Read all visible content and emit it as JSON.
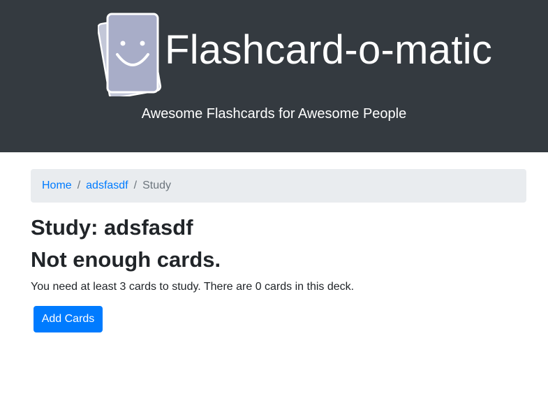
{
  "header": {
    "title": "Flashcard-o-matic",
    "tagline": "Awesome Flashcards for Awesome People",
    "logo_icon": "smiley-card-icon"
  },
  "breadcrumb": {
    "home": "Home",
    "deck": "adsfasdf",
    "current": "Study",
    "separator": "/"
  },
  "main": {
    "study_title": "Study: adsfasdf",
    "notice_title": "Not enough cards.",
    "notice_text": "You need at least 3 cards to study. There are 0 cards in this deck.",
    "add_cards_label": "Add Cards"
  },
  "colors": {
    "header_bg": "#343a40",
    "link": "#007bff",
    "breadcrumb_bg": "#e9ecef",
    "primary_button": "#007bff"
  }
}
